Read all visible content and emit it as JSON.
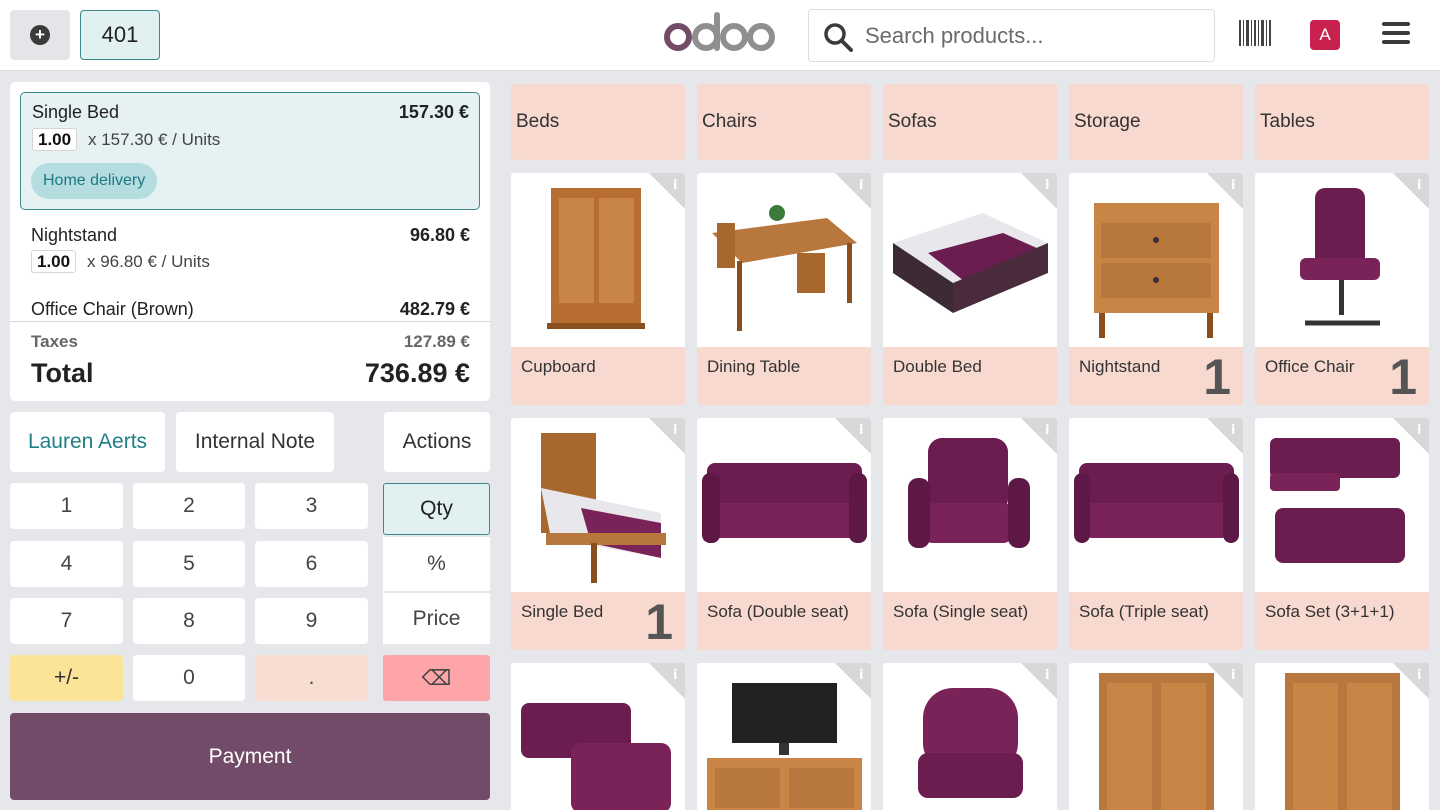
{
  "header": {
    "new_order_icon": "plus-circle-icon",
    "table_number": "401",
    "logo_text": "odoo",
    "search_placeholder": "Search products...",
    "barcode_icon": "barcode-icon",
    "user_initial": "A",
    "menu_icon": "hamburger-icon",
    "colors": {
      "brand": "#714b67",
      "accent": "#3a8a8a",
      "avatar": "#c8214e"
    }
  },
  "order": {
    "lines": [
      {
        "name": "Single Bed",
        "price": "157.30 €",
        "qty": "1.00",
        "unit_price": "x 157.30 € / Units",
        "tag": "Home delivery"
      },
      {
        "name": "Nightstand",
        "price": "96.80 €",
        "qty": "1.00",
        "unit_price": "x 96.80 € / Units"
      },
      {
        "name": "Office Chair (Brown)",
        "price": "482.79 €"
      }
    ],
    "taxes_label": "Taxes",
    "taxes_value": "127.89 €",
    "total_label": "Total",
    "total_value": "736.89 €"
  },
  "controls": {
    "customer": "Lauren Aerts",
    "note": "Internal Note",
    "actions": "Actions"
  },
  "numpad": {
    "digits": [
      "1",
      "2",
      "3",
      "4",
      "5",
      "6",
      "7",
      "8",
      "9",
      "+/-",
      "0",
      "."
    ],
    "modes": [
      "Qty",
      "%",
      "Price"
    ],
    "backspace": "⌫",
    "payment": "Payment"
  },
  "categories": [
    "Beds",
    "Chairs",
    "Sofas",
    "Storage",
    "Tables"
  ],
  "products": [
    {
      "name": "Cupboard",
      "count": ""
    },
    {
      "name": "Dining Table",
      "count": ""
    },
    {
      "name": "Double Bed",
      "count": ""
    },
    {
      "name": "Nightstand",
      "count": "1"
    },
    {
      "name": "Office Chair",
      "count": "1"
    },
    {
      "name": "Single Bed",
      "count": "1"
    },
    {
      "name": "Sofa (Double seat)",
      "count": ""
    },
    {
      "name": "Sofa (Single seat)",
      "count": ""
    },
    {
      "name": "Sofa (Triple seat)",
      "count": ""
    },
    {
      "name": "Sofa Set (3+1+1)",
      "count": ""
    },
    {
      "name": "",
      "count": ""
    },
    {
      "name": "",
      "count": ""
    },
    {
      "name": "",
      "count": ""
    },
    {
      "name": "",
      "count": ""
    },
    {
      "name": "",
      "count": ""
    }
  ]
}
